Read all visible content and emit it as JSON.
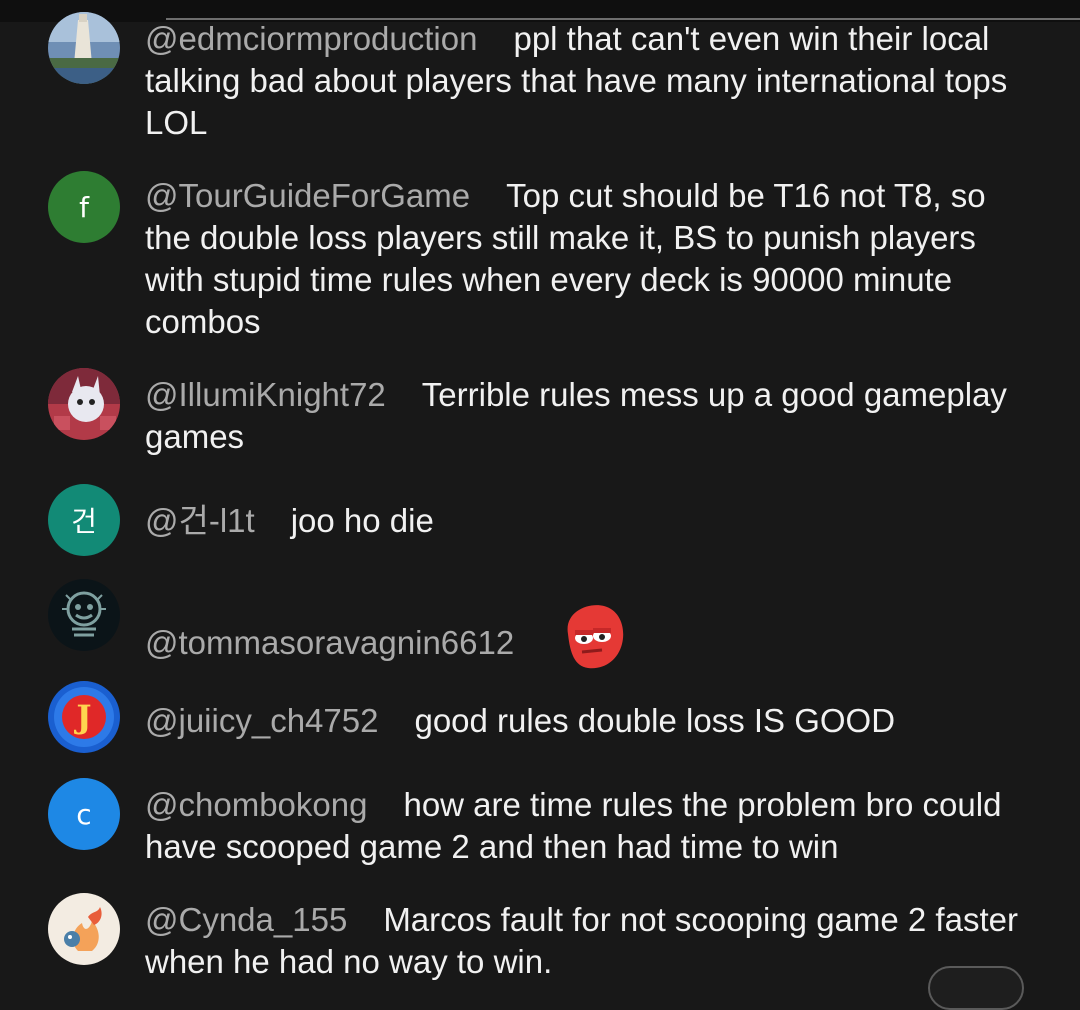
{
  "comments": [
    {
      "handle": "@edmciormproduction",
      "text": "ppl that can't even win their local talking bad about players that have many international tops LOL",
      "avatar": {
        "type": "image",
        "icon": "lighthouse-landscape-avatar"
      }
    },
    {
      "handle": "@TourGuideForGame",
      "text": "Top cut should be T16 not T8, so the double loss players still make it, BS to punish players with stupid time rules when every deck is 90000 minute combos",
      "avatar": {
        "type": "letter",
        "letter": "f",
        "color": "#2e7d32"
      }
    },
    {
      "handle": "@IllumiKnight72",
      "text": "Terrible rules mess up a good gameplay games",
      "avatar": {
        "type": "image",
        "icon": "cartoon-character-avatar"
      }
    },
    {
      "handle": "@건-l1t",
      "text": "joo ho die",
      "avatar": {
        "type": "letter",
        "letter": "건",
        "color": "#128a76"
      }
    },
    {
      "handle": "@tommasoravagnin6612",
      "text": "",
      "emoji": "red-blob-eyes-emoji",
      "avatar": {
        "type": "image",
        "icon": "dark-logo-avatar"
      }
    },
    {
      "handle": "@juiicy_ch4752",
      "text": "good rules double loss IS GOOD",
      "avatar": {
        "type": "image",
        "icon": "red-blue-logo-avatar"
      }
    },
    {
      "handle": "@chombokong",
      "text": "how are time rules the problem bro could have scooped game 2 and then had time to win",
      "avatar": {
        "type": "letter",
        "letter": "c",
        "color": "#1e88e5"
      }
    },
    {
      "handle": "@Cynda_155",
      "text": "Marcos fault for not scooping game 2 faster when he had no way to win.",
      "avatar": {
        "type": "image",
        "icon": "fire-creature-avatar"
      }
    }
  ]
}
